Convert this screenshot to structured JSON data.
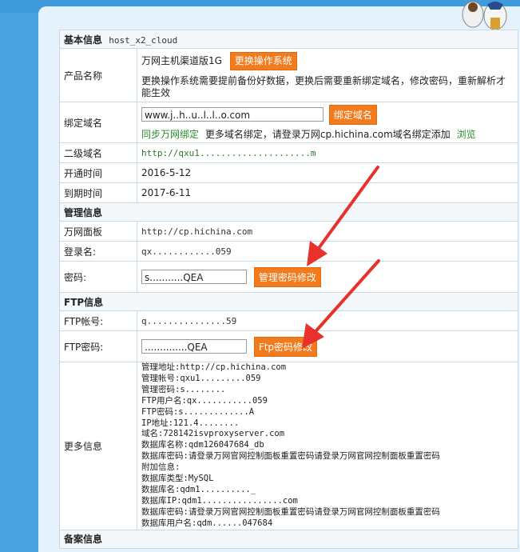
{
  "sections": {
    "basic_title": "基本信息",
    "basic_host": "host_x2_cloud",
    "manage_title": "管理信息",
    "ftp_title": "FTP信息",
    "record_title": "备案信息"
  },
  "product": {
    "label": "产品名称",
    "name": "万网主机渠道版1G",
    "change_os_button": "更换操作系统",
    "note": "更换操作系统需要提前备份好数据，更换后需要重新绑定域名，修改密码，重新解析才能生效"
  },
  "bind_domain": {
    "label": "绑定域名",
    "input_value": "www.j..h..u..l..l..o.com",
    "button": "绑定域名",
    "sync_text": "同步万网绑定",
    "more_text": "更多域名绑定，请登录万网cp.hichina.com域名绑定添加",
    "browse_link": "浏览"
  },
  "subdomain": {
    "label": "二级域名",
    "value": "http://qxu1.....................m"
  },
  "open_time": {
    "label": "开通时间",
    "value": "2016-5-12"
  },
  "expire_time": {
    "label": "到期时间",
    "value": "2017-6-11"
  },
  "manage": {
    "panel_label": "万网面板",
    "panel_value": "http://cp.hichina.com",
    "login_label": "登录名:",
    "login_value": "qx............059",
    "password_label": "密码:",
    "password_value": "s...........QEA",
    "password_button": "管理密码修改"
  },
  "ftp": {
    "account_label": "FTP帐号:",
    "account_value": "q...............59",
    "password_label": "FTP密码:",
    "password_value": "..............QEA",
    "password_button": "Ftp密码修改"
  },
  "more": {
    "label": "更多信息",
    "lines": [
      "管理地址:http://cp.hichina.com",
      "管理帐号:qxu1.........059",
      "管理密码:s........",
      "FTP用户名:qx...........059",
      "FTP密码:s.............A",
      "IP地址:121.4........",
      "域名:728142isvproxyserver.com",
      "数据库名称:qdm126047684_db",
      "数据库密码:请登录万网官网控制面板重置密码请登录万网官网控制面板重置密码",
      "附加信息:",
      "数据库类型:MySQL",
      "数据库名:qdm1.........._",
      "数据库IP:qdm1................com",
      "数据库密码:请登录万网官网控制面板重置密码请登录万网官网控制面板重置密码",
      "数据库用户名:qdm......047684"
    ]
  },
  "colors": {
    "button": "#f27b1e",
    "arrow": "#e8312a",
    "background": "#4aa3e0"
  }
}
